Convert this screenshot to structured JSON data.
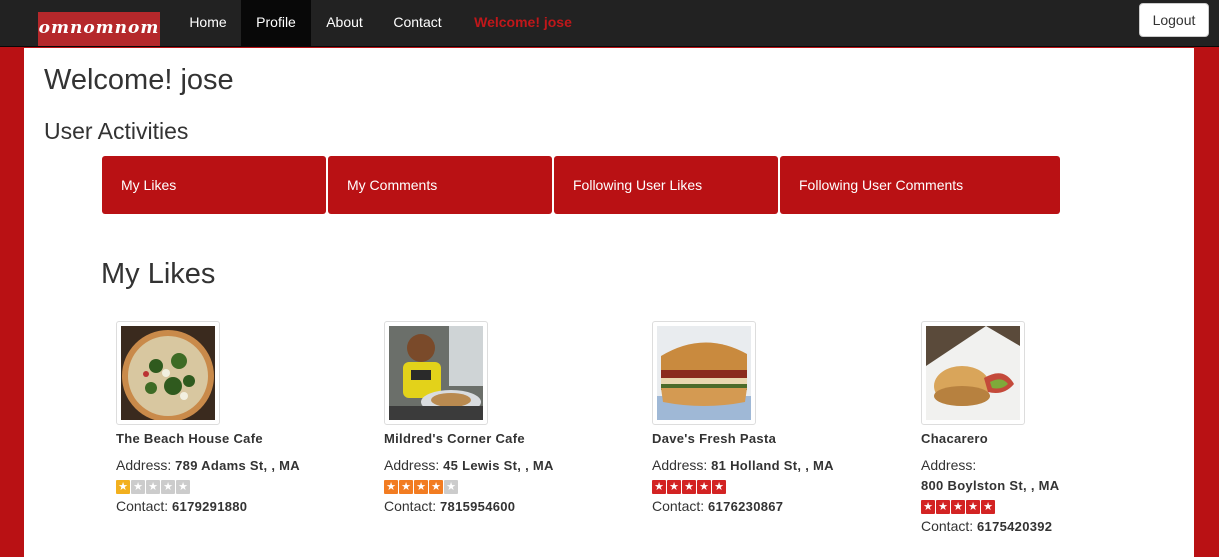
{
  "nav": {
    "brand": "omnomnom",
    "items": [
      "Home",
      "Profile",
      "About",
      "Contact"
    ],
    "active": "Profile",
    "welcome": "Welcome! jose",
    "logout": "Logout"
  },
  "page": {
    "title": "Welcome! jose",
    "section_title": "User Activities",
    "tabs": [
      "My Likes",
      "My Comments",
      "Following User Likes",
      "Following User Comments"
    ],
    "list_title": "My Likes"
  },
  "places": [
    {
      "name": "The Beach House Cafe",
      "address_label": "Address:",
      "address": "789 Adams St, , MA",
      "rating": 1,
      "contact_label": "Contact:",
      "contact": "6179291880"
    },
    {
      "name": "Mildred's Corner Cafe",
      "address_label": "Address:",
      "address": "45 Lewis St, , MA",
      "rating": 4,
      "contact_label": "Contact:",
      "contact": "7815954600"
    },
    {
      "name": "Dave's Fresh Pasta",
      "address_label": "Address:",
      "address": "81 Holland St, , MA",
      "rating": 5,
      "contact_label": "Contact:",
      "contact": "6176230867"
    },
    {
      "name": "Chacarero",
      "address_label": "Address:",
      "address": "800 Boylston St, , MA",
      "rating": 5,
      "contact_label": "Contact:",
      "contact": "6175420392"
    }
  ],
  "colors": {
    "brand_red": "#b91114",
    "star_1": "#f2b01e",
    "star_4": "#f27c21",
    "star_5": "#d32323",
    "star_empty": "#cccccc"
  }
}
